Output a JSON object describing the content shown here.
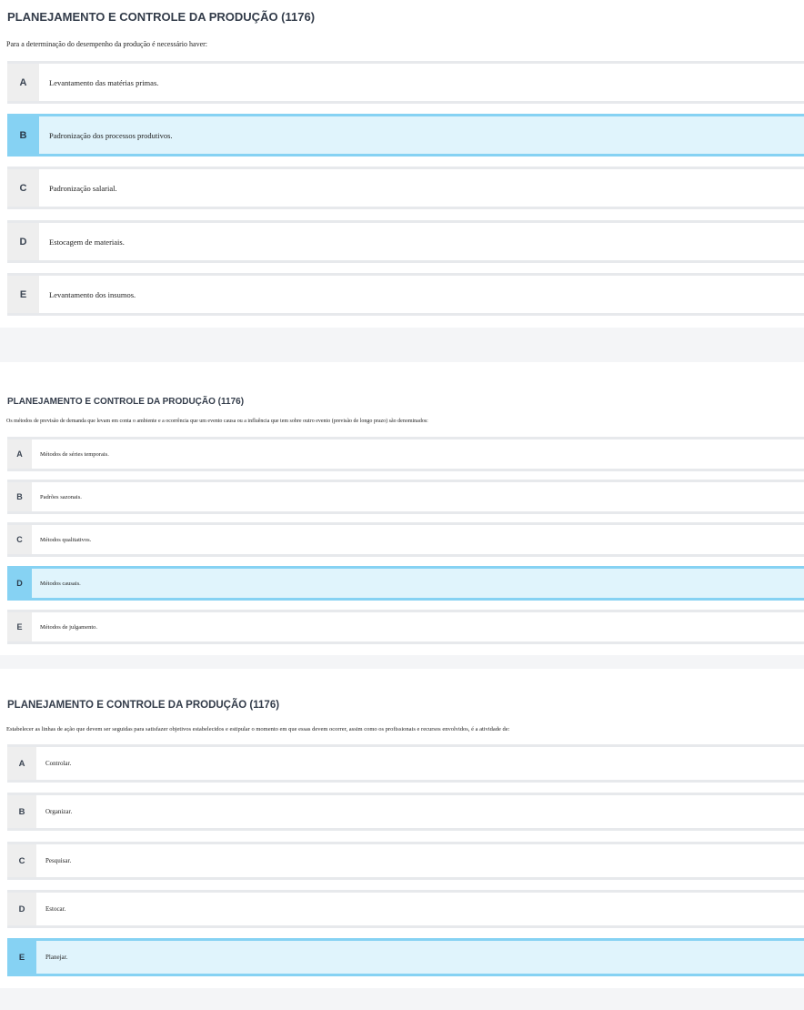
{
  "questions": [
    {
      "title": "PLANEJAMENTO E CONTROLE DA PRODUÇÃO (1176)",
      "prompt": "Para a determinação do desempenho da produção é necessário haver:",
      "selected": "B",
      "options": [
        {
          "letter": "A",
          "text": "Levantamento das matérias primas."
        },
        {
          "letter": "B",
          "text": "Padronização dos processos produtivos."
        },
        {
          "letter": "C",
          "text": "Padronização salarial."
        },
        {
          "letter": "D",
          "text": "Estocagem de materiais."
        },
        {
          "letter": "E",
          "text": "Levantamento dos insumos."
        }
      ]
    },
    {
      "title": "PLANEJAMENTO E CONTROLE DA PRODUÇÃO (1176)",
      "prompt": "Os métodos de previsão de demanda que levam em conta o ambiente e a ocorrência que um evento causa ou a influência que tem sobre outro evento (previsão de longo prazo) são denominados:",
      "selected": "D",
      "options": [
        {
          "letter": "A",
          "text": "Métodos de séries temporais."
        },
        {
          "letter": "B",
          "text": "Padrões sazonais."
        },
        {
          "letter": "C",
          "text": "Métodos qualitativos."
        },
        {
          "letter": "D",
          "text": "Métodos causais."
        },
        {
          "letter": "E",
          "text": "Métodos de julgamento."
        }
      ]
    },
    {
      "title": "PLANEJAMENTO E CONTROLE DA PRODUÇÃO (1176)",
      "prompt": "Estabelecer as linhas de ação que devem ser seguidas para satisfazer objetivos estabelecidos e estipular o momento em que essas devem ocorrer, assim como os profissionais e recursos envolvidos, é a atividade de:",
      "selected": "E",
      "options": [
        {
          "letter": "A",
          "text": "Controlar."
        },
        {
          "letter": "B",
          "text": "Organizar."
        },
        {
          "letter": "C",
          "text": "Pesquisar."
        },
        {
          "letter": "D",
          "text": "Estocar."
        },
        {
          "letter": "E",
          "text": "Planejar."
        }
      ]
    }
  ],
  "colors": {
    "selected_background": "#e0f4fc",
    "selected_accent": "#86d2f3",
    "letter_background": "#eeeeee"
  }
}
